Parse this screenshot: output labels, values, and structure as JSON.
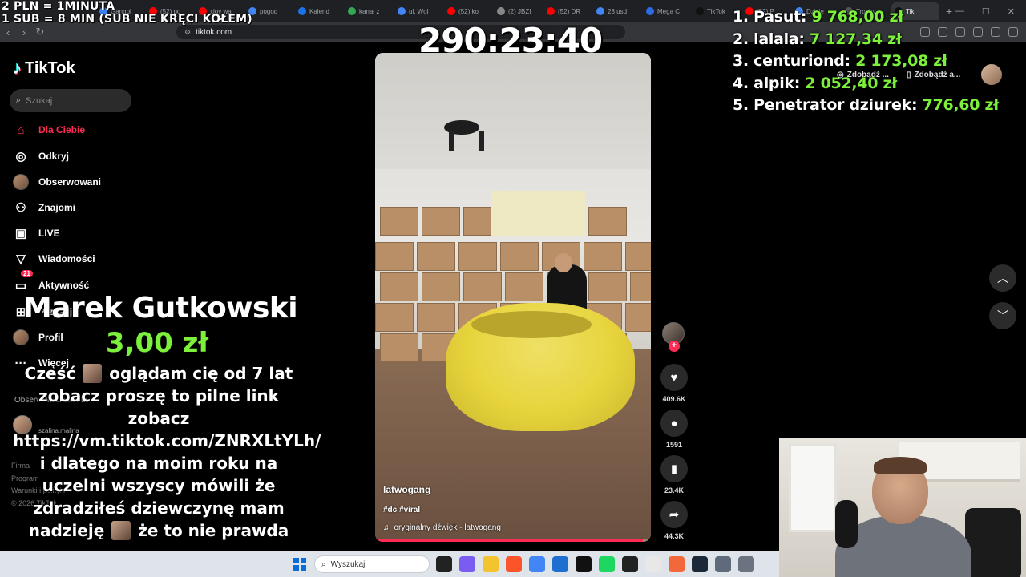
{
  "overlay": {
    "rate_line1": "2 PLN =  1MINUTA",
    "rate_line2": "1 SUB = 8 MIN (SUB NIE KRĘCI KOŁEM)",
    "timer": "290:23:40"
  },
  "browser": {
    "tabs": [
      "Gangpl",
      "(52) po",
      "xjoy wa",
      "pogod",
      "Kalend",
      "kanał z",
      "ul. Wol",
      "(52) ko",
      "(2) JBZI",
      "(52) DR",
      "28 usd",
      "Mega C",
      "TikTok",
      "(52) P",
      "Dzisie",
      "Trophy",
      "Tik"
    ],
    "url": "tiktok.com"
  },
  "sidebar": {
    "logo": "TikTok",
    "search_placeholder": "Szukaj",
    "items": [
      {
        "label": "Dla Ciebie",
        "icon": "home-icon"
      },
      {
        "label": "Odkryj",
        "icon": "compass-icon"
      },
      {
        "label": "Obserwowani",
        "icon": "following-avatar-icon"
      },
      {
        "label": "Znajomi",
        "icon": "friends-icon"
      },
      {
        "label": "LIVE",
        "icon": "live-icon"
      },
      {
        "label": "Wiadomości",
        "icon": "send-icon"
      },
      {
        "label": "Aktywność",
        "icon": "activity-icon",
        "badge": "21"
      },
      {
        "label": "Prześlij",
        "icon": "upload-icon"
      },
      {
        "label": "Profil",
        "icon": "profile-avatar-icon"
      },
      {
        "label": "Więcej",
        "icon": "more-icon"
      }
    ],
    "following_heading": "Obserwowane konta",
    "following_user": "szalina.malina",
    "footer": [
      "Firma",
      "Program",
      "Warunki i polityki",
      "© 2026 TikTok"
    ]
  },
  "donation": {
    "name": "Marek Gutkowski",
    "amount": "3,00 zł",
    "message_part1": "Cześć",
    "message_part2": "oglądam cię od 7 lat zobacz proszę to pilne link zobacz https://vm.tiktok.com/ZNRXLtYLh/ i dlatego na moim roku na uczelni wszyscy mówili że zdradziłeś dziewczynę mam nadzieję",
    "message_part3": "że to nie prawda"
  },
  "video": {
    "username": "latwogang",
    "tags": "#dc #viral",
    "sound": "oryginalny dźwięk - latwogang",
    "progress": 0.97
  },
  "actions": {
    "likes": "409.6K",
    "comments": "1591",
    "saves": "23.4K",
    "shares": "44.3K"
  },
  "header_buttons": {
    "get_coins": "Zdobądź ...",
    "get_app": "Zdobądź a..."
  },
  "leaderboard": [
    {
      "rank": "1.",
      "name": "Pasut:",
      "amount": "9 768,00 zł"
    },
    {
      "rank": "2.",
      "name": "lalala:",
      "amount": "7 127,34 zł"
    },
    {
      "rank": "3.",
      "name": "centuriond:",
      "amount": "2 173,08 zł"
    },
    {
      "rank": "4.",
      "name": "alpik:",
      "amount": "2 052,40 zł"
    },
    {
      "rank": "5.",
      "name": "Penetrator dziurek:",
      "amount": "776,60 zł"
    }
  ],
  "taskbar": {
    "search_placeholder": "Wyszukaj"
  },
  "colors": {
    "tiktok_red": "#fe2c55",
    "amount_green": "#7cf03a",
    "background": "#000000"
  }
}
